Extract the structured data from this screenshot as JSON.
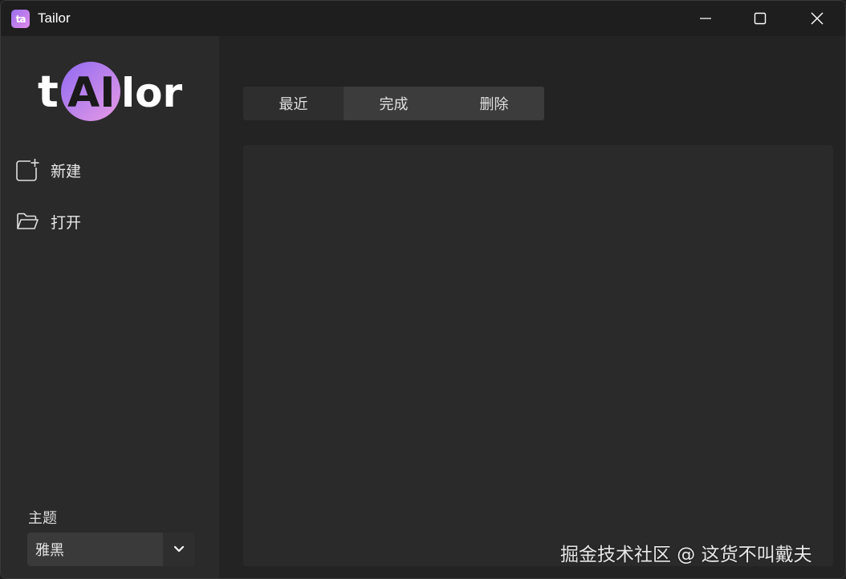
{
  "window": {
    "title": "Tailor",
    "app_icon_text": "ta"
  },
  "sidebar": {
    "logo": {
      "left": "t",
      "middle": "AI",
      "right": "lor"
    },
    "items": [
      {
        "label": "新建",
        "icon": "new-file-icon"
      },
      {
        "label": "打开",
        "icon": "folder-open-icon"
      }
    ],
    "theme": {
      "label": "主题",
      "selected": "雅黑"
    }
  },
  "main": {
    "tabs": [
      {
        "label": "最近"
      },
      {
        "label": "完成"
      },
      {
        "label": "删除"
      }
    ]
  },
  "watermark": "掘金技术社区 @ 这货不叫戴夫",
  "colors": {
    "accent_gradient_start": "#9a6ff0",
    "accent_gradient_end": "#e08ae8",
    "background": "#232323",
    "sidebar": "#2a2a2a"
  }
}
